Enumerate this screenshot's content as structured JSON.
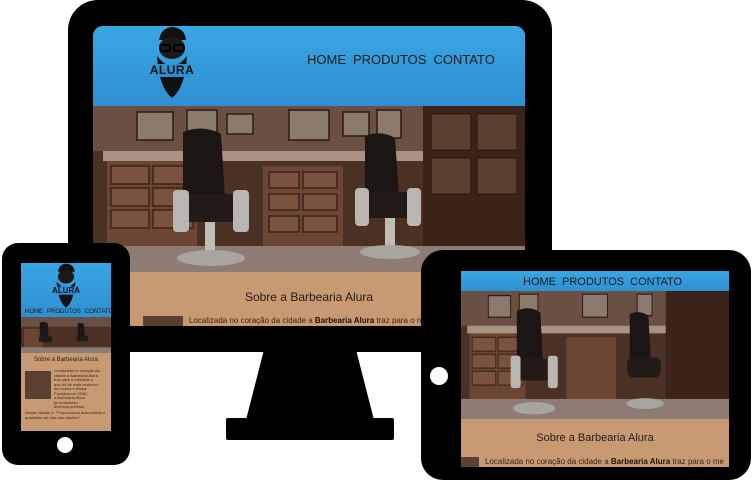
{
  "site": {
    "logo_text": "ALURA",
    "nav": [
      "HOME",
      "PRODUTOS",
      "CONTATO"
    ],
    "about_title": "Sobre a Barbearia Alura",
    "about_text_prefix": "Localizada no coração da cidade a ",
    "about_text_brand": "Barbearia Alura",
    "about_text_suffix": " traz para o merc",
    "tablet_about_text_suffix": " traz para o me",
    "phone_about_lines": [
      "Localizada no coração da",
      "cidade a Barbearia Alura",
      "traz para o mercado o",
      "que há de mais moderno",
      "em cortes e barba.",
      "Fundada em 2016,",
      "a Barbearia Alura",
      "já conquistou",
      "diversos prêmios"
    ],
    "phone_quote": "Nossa missão é: \"Proporcionar auto-estima e qualidade de vida aos clientes\"."
  },
  "colors": {
    "header_blue": "#3aa6e4",
    "about_tan": "#c79a73",
    "device_frame": "#000000"
  }
}
